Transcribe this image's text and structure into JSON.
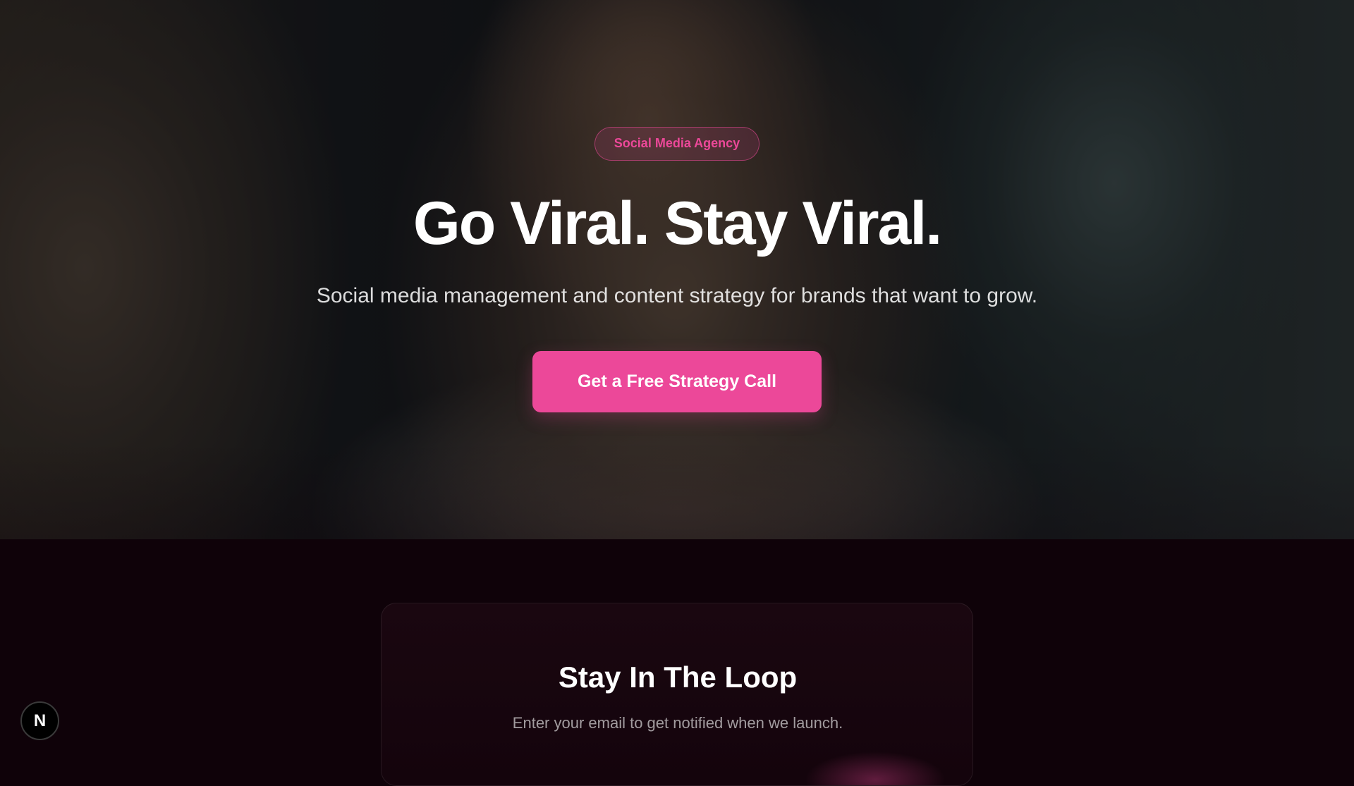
{
  "hero": {
    "background_image": "selfie-woman-with-headphones",
    "badge": "Social Media Agency",
    "headline": "Go Viral. Stay Viral.",
    "subheadline": "Social media management and content strategy for brands that want to grow.",
    "cta_label": "Get a Free Strategy Call"
  },
  "newsletter": {
    "title": "Stay In The Loop",
    "subtitle": "Enter your email to get notified when we launch."
  },
  "dev_indicator": {
    "icon": "nextjs-logo-icon",
    "label": "N"
  },
  "colors": {
    "accent": "#ec4899",
    "page_background": "#0f0209",
    "text_primary": "#ffffff"
  }
}
